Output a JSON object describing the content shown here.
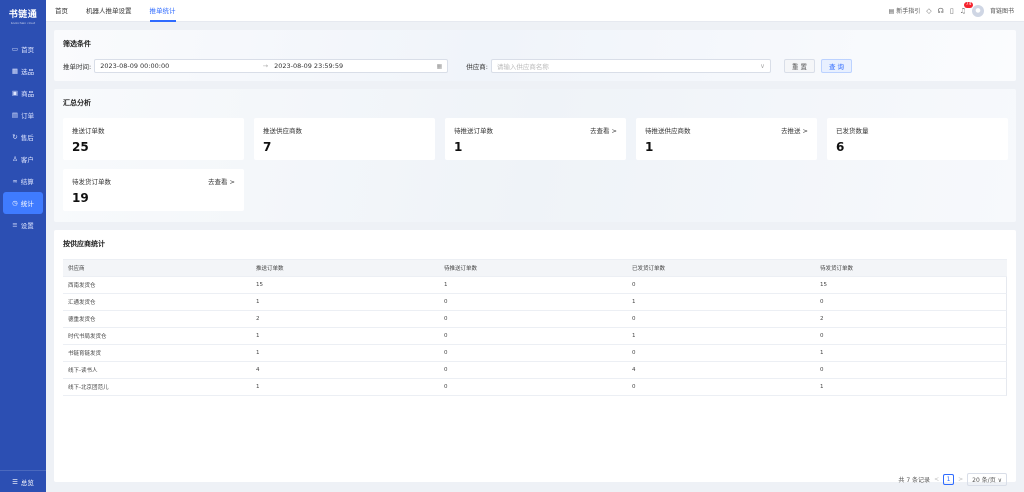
{
  "app": {
    "logo": "书链通",
    "logo_sub": "bookchain cloud"
  },
  "sidebar": {
    "items": [
      {
        "label": "首页",
        "icon": "monitor-icon"
      },
      {
        "label": "选品",
        "icon": "grid-icon"
      },
      {
        "label": "商品",
        "icon": "box-icon"
      },
      {
        "label": "订单",
        "icon": "document-icon"
      },
      {
        "label": "售后",
        "icon": "refresh-icon"
      },
      {
        "label": "客户",
        "icon": "users-icon"
      },
      {
        "label": "结算",
        "icon": "link-icon"
      },
      {
        "label": "统计",
        "icon": "clock-icon",
        "active": true
      },
      {
        "label": "设置",
        "icon": "settings-icon"
      }
    ],
    "bottom": "总览"
  },
  "topbar": {
    "tabs": [
      "首页",
      "机器人推单设置",
      "推单统计"
    ],
    "active_tab": "推单统计",
    "guide": "新手指引",
    "notification_count": "74",
    "username": "育链图书"
  },
  "filter": {
    "title": "筛选条件",
    "time_label": "推单时间:",
    "start": "2023-08-09 00:00:00",
    "range_sep": "→",
    "end": "2023-08-09 23:59:59",
    "supplier_label": "供应商:",
    "supplier_placeholder": "请输入供应商名称",
    "reset": "重 置",
    "query": "查 询"
  },
  "summary": {
    "title": "汇总分析",
    "stats": [
      {
        "label": "推送订单数",
        "value": "25",
        "link": ""
      },
      {
        "label": "推送供应商数",
        "value": "7",
        "link": ""
      },
      {
        "label": "待推送订单数",
        "value": "1",
        "link": "去查看 >"
      },
      {
        "label": "待推送供应商数",
        "value": "1",
        "link": "去推送 >"
      },
      {
        "label": "已发货数量",
        "value": "6",
        "link": ""
      },
      {
        "label": "待发货订单数",
        "value": "19",
        "link": "去查看 >"
      }
    ]
  },
  "table": {
    "title": "按供应商统计",
    "columns": [
      "供应商",
      "推送订单数",
      "待推送订单数",
      "已发货订单数",
      "待发货订单数"
    ],
    "rows": [
      [
        "西南发货仓",
        "15",
        "1",
        "0",
        "15"
      ],
      [
        "汇通发货仓",
        "1",
        "0",
        "1",
        "0"
      ],
      [
        "德重发货仓",
        "2",
        "0",
        "0",
        "2"
      ],
      [
        "时代书局发货仓",
        "1",
        "0",
        "1",
        "0"
      ],
      [
        "书链育链发货",
        "1",
        "0",
        "0",
        "1"
      ],
      [
        "线下-读书人",
        "4",
        "0",
        "4",
        "0"
      ],
      [
        "线下-北京团范儿",
        "1",
        "0",
        "0",
        "1"
      ]
    ]
  },
  "pagination": {
    "total": "共 7 条记录",
    "prev": "<",
    "page": "1",
    "next": ">",
    "size": "20 条/页 ∨"
  },
  "colors": {
    "sidebar": "#2c4fb3",
    "accent": "#2f6bff",
    "active_nav": "#3f7bff"
  }
}
